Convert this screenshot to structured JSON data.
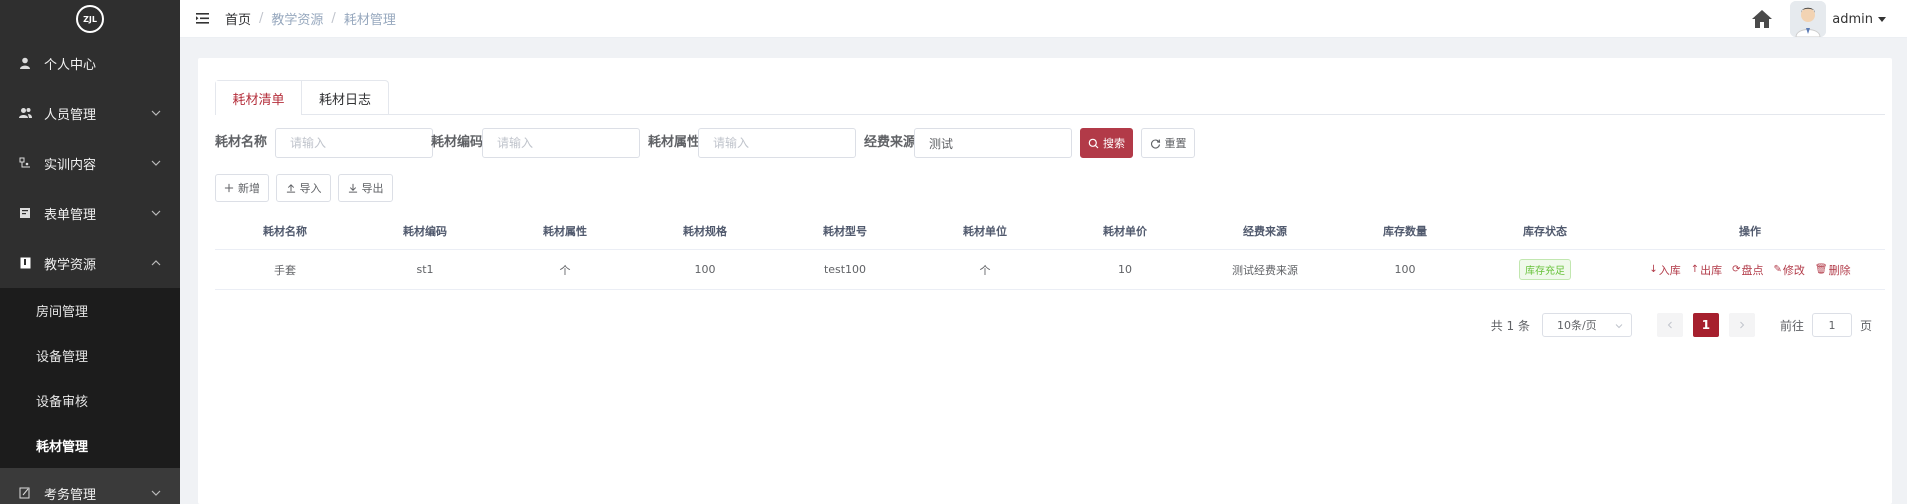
{
  "sidebar": {
    "logo_text": "ZJL",
    "items": [
      {
        "label": "个人中心",
        "icon": "user-icon",
        "has_children": false
      },
      {
        "label": "人员管理",
        "icon": "users-icon",
        "has_children": true
      },
      {
        "label": "实训内容",
        "icon": "training-icon",
        "has_children": true
      },
      {
        "label": "表单管理",
        "icon": "form-icon",
        "has_children": true
      },
      {
        "label": "教学资源",
        "icon": "book-icon",
        "has_children": true,
        "expanded": true
      }
    ],
    "subitems": [
      {
        "label": "房间管理"
      },
      {
        "label": "设备管理"
      },
      {
        "label": "设备审核"
      },
      {
        "label": "耗材管理",
        "active": true
      }
    ],
    "last_item": {
      "label": "考务管理",
      "icon": "exam-icon"
    }
  },
  "header": {
    "breadcrumb": [
      "首页",
      "教学资源",
      "耗材管理"
    ],
    "username": "admin"
  },
  "tabs": [
    "耗材清单",
    "耗材日志"
  ],
  "filters": {
    "name_label": "耗材名称",
    "name_placeholder": "请输入",
    "code_label": "耗材编码",
    "code_placeholder": "请输入",
    "attr_label": "耗材属性",
    "attr_placeholder": "请输入",
    "fund_label": "经费来源",
    "fund_value": "测试",
    "search_label": "搜索",
    "reset_label": "重置"
  },
  "actions": {
    "add": "新增",
    "import": "导入",
    "export": "导出"
  },
  "table": {
    "headers": [
      "耗材名称",
      "耗材编码",
      "耗材属性",
      "耗材规格",
      "耗材型号",
      "耗材单位",
      "耗材单价",
      "经费来源",
      "库存数量",
      "库存状态",
      "操作"
    ],
    "rows": [
      {
        "name": "手套",
        "code": "st1",
        "attr": "个",
        "spec": "100",
        "model": "test100",
        "unit": "个",
        "price": "10",
        "fund": "测试经费来源",
        "stock": "100",
        "status": "库存充足",
        "ops": [
          "入库",
          "出库",
          "盘点",
          "修改",
          "删除"
        ]
      }
    ]
  },
  "pagination": {
    "total": "共 1 条",
    "page_size": "10条/页",
    "current": "1",
    "goto_prefix": "前往",
    "goto_value": "1",
    "goto_suffix": "页"
  },
  "colors": {
    "accent": "#b23a48",
    "sidebar_bg": "#2f2f2f",
    "submenu_bg": "#1c1c1c",
    "status_green": "#67c23a"
  }
}
